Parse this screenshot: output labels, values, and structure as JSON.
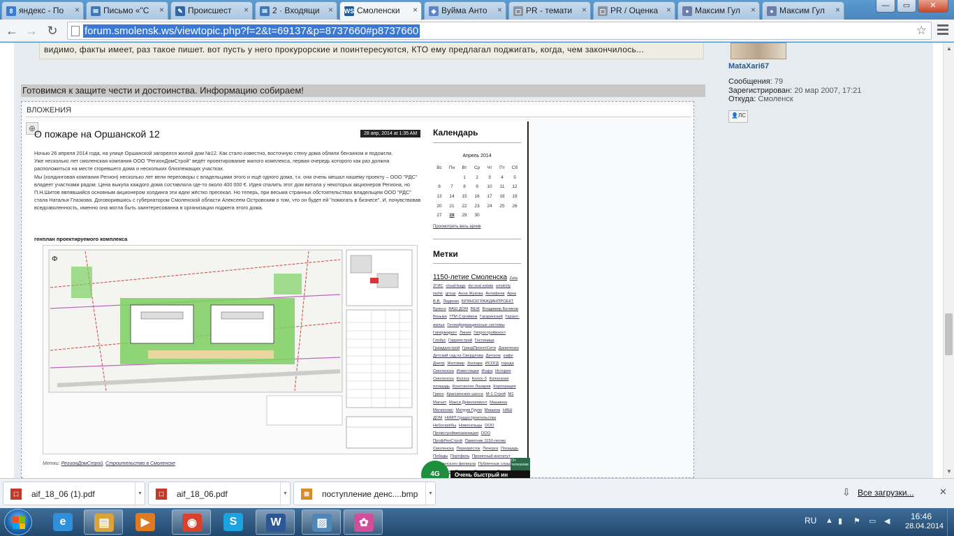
{
  "browser": {
    "tabs": [
      {
        "label": "яндекс - По",
        "icon_text": "8",
        "icon_color": "#3a7bd5",
        "active": false
      },
      {
        "label": "Письмо «\"С",
        "icon_text": "✉",
        "icon_color": "#3d78b8",
        "active": false
      },
      {
        "label": "Происшест",
        "icon_text": "✎",
        "icon_color": "#2f66a8",
        "active": false
      },
      {
        "label": "2 · Входящи",
        "icon_text": "✉",
        "icon_color": "#3d78b8",
        "active": false
      },
      {
        "label": "Смоленски",
        "icon_text": "WS",
        "icon_color": "#1a5ea3",
        "active": true
      },
      {
        "label": "Вуйма Анто",
        "icon_text": "◆",
        "icon_color": "#5a86c8",
        "active": false
      },
      {
        "label": "PR - темати",
        "icon_text": "▢",
        "icon_color": "#8a94a0",
        "active": false
      },
      {
        "label": "PR / Оценка",
        "icon_text": "▢",
        "icon_color": "#8a94a0",
        "active": false
      },
      {
        "label": "Максим Гул",
        "icon_text": "●",
        "icon_color": "#6a7ea8",
        "active": false
      },
      {
        "label": "Максим Гул",
        "icon_text": "●",
        "icon_color": "#6a7ea8",
        "active": false
      }
    ],
    "url": "forum.smolensk.ws/viewtopic.php?f=2&t=69137&p=8737660#p8737660",
    "window_buttons": {
      "minimize": "—",
      "maximize": "▭",
      "close": "✕"
    }
  },
  "forum": {
    "quote_text": "видимо, факты имеет, раз такое пишет. вот пусть у него прокурорские и поинтересуются, КТО ему предлагал поджигать, когда, чем закончилось...",
    "post_text": "Готовимся к защите чести и достоинства. Информацию собираем!",
    "attachments_label": "ВЛОЖЕНИЯ",
    "user": {
      "name": "MataXari67",
      "posts_label": "Сообщения:",
      "posts_value": "79",
      "registered_label": "Зарегистрирован:",
      "registered_value": "20 мар 2007, 17:21",
      "from_label": "Откуда:",
      "from_value": "Смоленск",
      "pm_label": "ЛС"
    }
  },
  "article": {
    "title": "О пожаре на Оршанской 12",
    "date": "28 апр, 2014 at 1:35 AM",
    "paragraphs": [
      "Ночью 26 апреля 2014 года, на улице Оршанской загорелся жилой дом №12. Как стало известно, восточную стену дома облили бензином и подожгли.",
      "Уже несколько лет смоленская компания ООО \"РегионДомСтрой\" ведёт проектирование жилого комплекса, первая очередь которого как раз должна расположиться на месте сгоревшего дома и нескольких близлежащих участках.",
      "Мы (холдинговая компания Регион) несколько лет вели переговоры с владельцами этого и ещё одного дома, т.к. они очень мешал нашему проекту – ООО \"РДС\" владеет участками рядом. Цена выкупа каждого дома составляла где-то около 400 000 €. Идея спалить этот дом витала у некоторых акционеров Региона, но П.Н.Шитов являвшийся основным акционером холдинга эти идеи жёстко пресекал. Но теперь, при весьма странных обстоятельствах владельцем ООО \"РДС\" стала Наталья Глазкова. Договорившись с губернатором Смоленской области Алексеем Островским о том, что он будет ей \"помогать в бизнесе\". И, почувствовав вседозволенность, именно она могла быть заинтересованна в организации поджега этого дома."
    ],
    "subheading": "генплан проектируемого комплекса",
    "meta_label": "Метки",
    "meta_tags": [
      "РегионДомСтрой",
      "Строительство в Смоленске"
    ]
  },
  "sidebar": {
    "calendar_title": "Календарь",
    "month": "Апрель 2014",
    "weekdays": [
      "Вс",
      "Пн",
      "Вт",
      "Ср",
      "Чт",
      "Пт",
      "Сб"
    ],
    "weeks": [
      [
        "",
        "",
        "1",
        "2",
        "3",
        "4",
        "5"
      ],
      [
        "6",
        "7",
        "8",
        "9",
        "10",
        "11",
        "12"
      ],
      [
        "13",
        "14",
        "15",
        "16",
        "17",
        "18",
        "19"
      ],
      [
        "20",
        "21",
        "22",
        "23",
        "24",
        "25",
        "26"
      ],
      [
        "27",
        "28",
        "29",
        "30",
        "",
        "",
        ""
      ]
    ],
    "today": "28",
    "archive_link": "Просмотреть весь архив",
    "tags_title": "Метки",
    "tag_big": "1150-летие Смоленска",
    "tags": [
      "Zeta",
      "2ГИС",
      "cloud-bags",
      "dvi real estate",
      "smolcity",
      "tashir",
      "group",
      "Анна Жукова",
      "Антифеев",
      "Арка",
      "В.В.",
      "Лиденко",
      "БРЯНСКГРАЖДАНПРОЕКТ",
      "Брянск",
      "ВАШ ДОМ",
      "ВЕЖ",
      "Владимир Беликов",
      "Вязьма",
      "ГПИ Стройинж",
      "Гагаринский",
      "Гарант-жилье",
      "Геоинформационные системы",
      "Гипермаркет",
      "Линия",
      "Гипростройиност",
      "Глобус",
      "Горреестрой",
      "Гостиница",
      "Гражданстрой",
      "ГрандПроектСити",
      "Даниленко",
      "Детский сад на Свердлова",
      "Детское",
      "кафе",
      "Днепр",
      "Житомир",
      "Зоопарк",
      "ИСОГД",
      "города",
      "Смоленска",
      "Инвестиции",
      "Искра",
      "История",
      "Смоленска",
      "Колхоз",
      "Колос-3",
      "Колхозная",
      "площадь",
      "Константин Лазарев",
      "Корпорация",
      "Гринн",
      "Краснинское шоссе",
      "М-1 Строй",
      "М1",
      "Магнит",
      "Макси Девелопмент",
      "Машинка",
      "Мегаполис",
      "Метрум Групп",
      "Мишина",
      "НАШ ДОМ",
      "НИИП Градостроительства",
      "Небоскрёбы",
      "Новосельцы",
      "ООО Промстроймеханизация",
      "ООО",
      "ПрофРенСтрой",
      "Памятник 1150-летию",
      "Смоленска",
      "Перекрёсток",
      "Печерск",
      "Площадь",
      "Победы",
      "Портфель",
      "Проектный институт",
      "Смоленского филиала",
      "Публичные слушания",
      "Пятёрочка",
      "Развитие Смоленска",
      "Рекстор",
      "РегионДомСтрой",
      "Росгос"
    ],
    "ad_badge": "4G",
    "ad_text": "Очень быстрый ин",
    "ad_mini": "От телекомм"
  },
  "downloads": {
    "items": [
      {
        "name": "aif_18_06 (1).pdf",
        "type": "pdf"
      },
      {
        "name": "aif_18_06.pdf",
        "type": "pdf"
      },
      {
        "name": "поступление денс....bmp",
        "type": "bmp"
      }
    ],
    "all_label": "Все загрузки...",
    "close": "✕"
  },
  "taskbar": {
    "apps": [
      {
        "name": "ie",
        "glyph": "e",
        "color": "#2f8fd8",
        "active": false
      },
      {
        "name": "explorer",
        "glyph": "▤",
        "color": "#d9a53a",
        "active": true
      },
      {
        "name": "media-player",
        "glyph": "▶",
        "color": "#e07a20",
        "active": false
      },
      {
        "name": "chrome",
        "glyph": "◉",
        "color": "#d9412f",
        "active": true
      },
      {
        "name": "skype",
        "glyph": "S",
        "color": "#1aa3e0",
        "active": false
      },
      {
        "name": "word",
        "glyph": "W",
        "color": "#2b5797",
        "active": true
      },
      {
        "name": "photo-viewer",
        "glyph": "▨",
        "color": "#4f86b8",
        "active": true
      },
      {
        "name": "icq",
        "glyph": "✿",
        "color": "#d14f9a",
        "active": true
      }
    ],
    "lang": "RU",
    "time": "16:46",
    "date": "28.04.2014"
  },
  "colors": {
    "accent": "#3a78d6",
    "taskbar": "#2a5580",
    "post_bar": "#c8c8c8",
    "quote_bg": "#eeede3"
  }
}
